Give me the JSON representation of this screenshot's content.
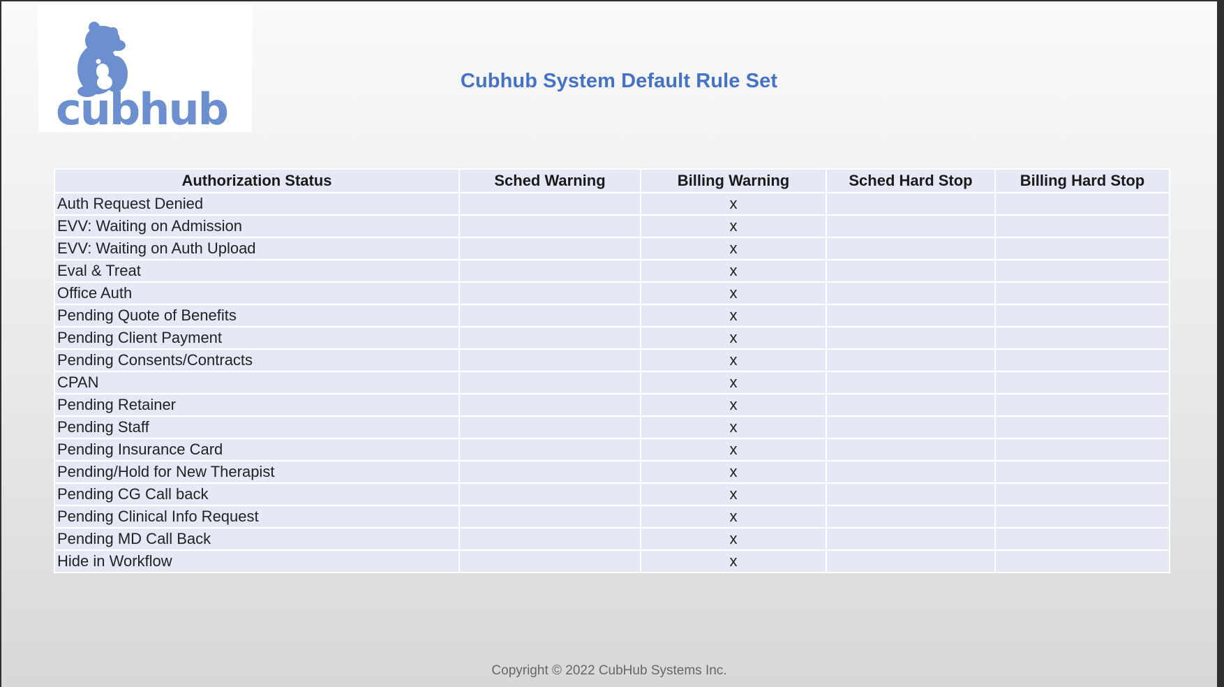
{
  "header": {
    "logo_text": "cubhub",
    "title": "Cubhub System Default Rule Set"
  },
  "table": {
    "columns": [
      "Authorization Status",
      "Sched Warning",
      "Billing Warning",
      "Sched Hard Stop",
      "Billing Hard Stop"
    ],
    "rows": [
      {
        "status": "Auth Request Denied",
        "sched_warning": "",
        "billing_warning": "x",
        "sched_hard_stop": "",
        "billing_hard_stop": ""
      },
      {
        "status": "EVV: Waiting on Admission",
        "sched_warning": "",
        "billing_warning": "x",
        "sched_hard_stop": "",
        "billing_hard_stop": ""
      },
      {
        "status": "EVV: Waiting on Auth Upload",
        "sched_warning": "",
        "billing_warning": "x",
        "sched_hard_stop": "",
        "billing_hard_stop": ""
      },
      {
        "status": "Eval & Treat",
        "sched_warning": "",
        "billing_warning": "x",
        "sched_hard_stop": "",
        "billing_hard_stop": ""
      },
      {
        "status": "Office Auth",
        "sched_warning": "",
        "billing_warning": "x",
        "sched_hard_stop": "",
        "billing_hard_stop": ""
      },
      {
        "status": "Pending Quote of Benefits",
        "sched_warning": "",
        "billing_warning": "x",
        "sched_hard_stop": "",
        "billing_hard_stop": ""
      },
      {
        "status": "Pending Client Payment",
        "sched_warning": "",
        "billing_warning": "x",
        "sched_hard_stop": "",
        "billing_hard_stop": ""
      },
      {
        "status": "Pending Consents/Contracts",
        "sched_warning": "",
        "billing_warning": "x",
        "sched_hard_stop": "",
        "billing_hard_stop": ""
      },
      {
        "status": "CPAN",
        "sched_warning": "",
        "billing_warning": "x",
        "sched_hard_stop": "",
        "billing_hard_stop": ""
      },
      {
        "status": "Pending Retainer",
        "sched_warning": "",
        "billing_warning": "x",
        "sched_hard_stop": "",
        "billing_hard_stop": ""
      },
      {
        "status": "Pending Staff",
        "sched_warning": "",
        "billing_warning": "x",
        "sched_hard_stop": "",
        "billing_hard_stop": ""
      },
      {
        "status": "Pending Insurance Card",
        "sched_warning": "",
        "billing_warning": "x",
        "sched_hard_stop": "",
        "billing_hard_stop": ""
      },
      {
        "status": "Pending/Hold for New Therapist",
        "sched_warning": "",
        "billing_warning": "x",
        "sched_hard_stop": "",
        "billing_hard_stop": ""
      },
      {
        "status": "Pending CG Call back",
        "sched_warning": "",
        "billing_warning": "x",
        "sched_hard_stop": "",
        "billing_hard_stop": ""
      },
      {
        "status": "Pending Clinical Info Request",
        "sched_warning": "",
        "billing_warning": "x",
        "sched_hard_stop": "",
        "billing_hard_stop": ""
      },
      {
        "status": "Pending MD Call Back",
        "sched_warning": "",
        "billing_warning": "x",
        "sched_hard_stop": "",
        "billing_hard_stop": ""
      },
      {
        "status": "Hide in Workflow",
        "sched_warning": "",
        "billing_warning": "x",
        "sched_hard_stop": "",
        "billing_hard_stop": ""
      }
    ]
  },
  "footer": {
    "copyright": "Copyright © 2022 CubHub Systems Inc."
  },
  "colors": {
    "brand_blue": "#4472c4",
    "logo_blue": "#6b8fcf",
    "table_cell_bg": "#e6e9f5"
  }
}
